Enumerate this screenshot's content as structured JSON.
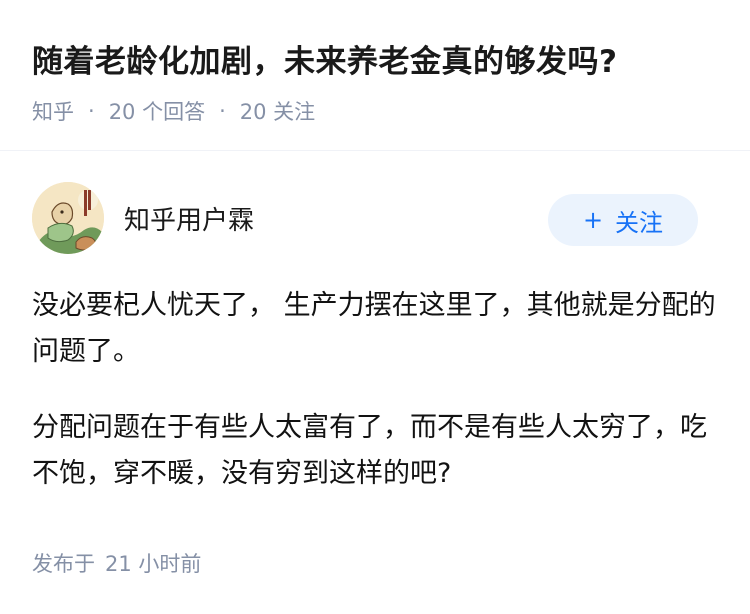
{
  "question": {
    "title": "随着老龄化加剧，未来养老金真的够发吗?",
    "meta": {
      "source": "知乎",
      "separator": "·",
      "answers": "20 个回答",
      "follows": "20 关注"
    }
  },
  "author": {
    "name": "知乎用户霖",
    "follow_plus": "+",
    "follow_label": "关注"
  },
  "answer": {
    "paragraphs": [
      "没必要杞人忧天了， 生产力摆在这里了，其他就是分配的问题了。",
      "分配问题在于有些人太富有了，而不是有些人太穷了，吃不饱，穿不暖，没有穷到这样的吧?"
    ]
  },
  "publish": {
    "prefix": "发布于",
    "time": "21 小时前"
  },
  "colors": {
    "meta_gray": "#8590a6",
    "follow_blue": "#1772f6",
    "follow_bg": "#ebf3fd",
    "divider": "#f0f2f7"
  }
}
